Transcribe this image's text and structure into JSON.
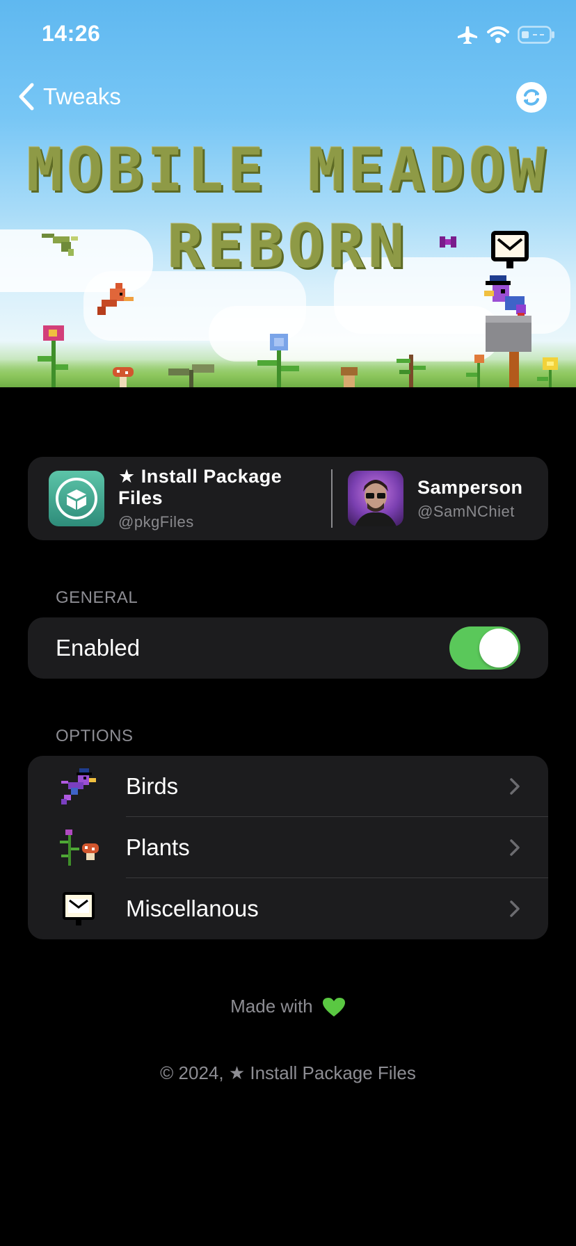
{
  "status_bar": {
    "time": "14:26",
    "icons": [
      "airplane-icon",
      "wifi-icon",
      "battery-icon"
    ]
  },
  "nav": {
    "back_label": "Tweaks",
    "refresh_icon": "refresh-icon"
  },
  "banner": {
    "title_line1": "MOBILE MEADOW",
    "title_line2": "REBORN"
  },
  "credits": [
    {
      "name": "★ Install Package Files",
      "handle": "@pkgFiles",
      "icon": "package-icon"
    },
    {
      "name": "Samperson",
      "handle": "@SamNChiet",
      "icon": "avatar"
    }
  ],
  "general": {
    "header": "GENERAL",
    "enabled_label": "Enabled",
    "enabled": true
  },
  "options": {
    "header": "OPTIONS",
    "items": [
      {
        "label": "Birds",
        "icon": "bird-icon"
      },
      {
        "label": "Plants",
        "icon": "plant-icon"
      },
      {
        "label": "Miscellanous",
        "icon": "mailbox-sign-icon"
      }
    ]
  },
  "footer": {
    "made_with": "Made with",
    "copyright": "© 2024, ★ Install Package Files"
  },
  "colors": {
    "accent_green": "#5ac85a",
    "card_bg": "#1c1c1e",
    "secondary_text": "#8d8d93"
  }
}
